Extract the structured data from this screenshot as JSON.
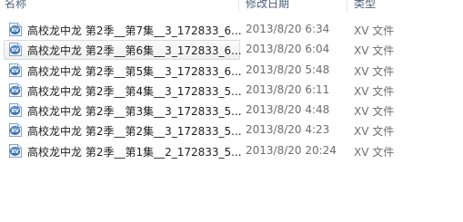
{
  "header": {
    "name": "名称",
    "date_modified": "修改日期",
    "type": "类型"
  },
  "files": [
    {
      "name": "高校龙中龙 第2季__第7集__3_172833_6...",
      "date": "2013/8/20 6:34",
      "type": "XV 文件",
      "icon": "xv-file-icon",
      "selected": false
    },
    {
      "name": "高校龙中龙 第2季__第6集__3_172833_6...",
      "date": "2013/8/20 6:04",
      "type": "XV 文件",
      "icon": "xv-file-icon",
      "selected": true
    },
    {
      "name": "高校龙中龙 第2季__第5集__3_172833_6...",
      "date": "2013/8/20 5:48",
      "type": "XV 文件",
      "icon": "xv-file-icon",
      "selected": false
    },
    {
      "name": "高校龙中龙 第2季__第4集__3_172833_5...",
      "date": "2013/8/20 6:11",
      "type": "XV 文件",
      "icon": "xv-file-icon",
      "selected": false
    },
    {
      "name": "高校龙中龙 第2季__第3集__3_172833_5...",
      "date": "2013/8/20 4:48",
      "type": "XV 文件",
      "icon": "xv-file-icon",
      "selected": false
    },
    {
      "name": "高校龙中龙 第2季__第2集__3_172833_5...",
      "date": "2013/8/20 4:23",
      "type": "XV 文件",
      "icon": "xv-file-icon",
      "selected": false
    },
    {
      "name": "高校龙中龙 第2季__第1集__2_172833_5...",
      "date": "2013/8/20 20:24",
      "type": "XV 文件",
      "icon": "xv-file-icon",
      "selected": false
    }
  ],
  "colors": {
    "header_text": "#4c607a",
    "selection_border": "#d9d9d9",
    "icon_blue": "#3a6fb0"
  }
}
